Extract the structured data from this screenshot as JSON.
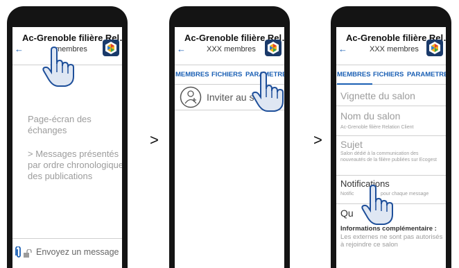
{
  "separators": {
    "first": ">",
    "second": ">"
  },
  "screen1": {
    "title": "Ac-Grenoble filière Rel…",
    "members": "membres",
    "annotation_1": "Page-écran des échanges",
    "annotation_2": "> Messages présentés par ordre chronologique des publications",
    "compose_placeholder": "Envoyez un message"
  },
  "screen2": {
    "title": "Ac-Grenoble filière Rel…",
    "members": "XXX membres",
    "tabs": [
      "MEMBRES",
      "FICHIERS",
      "PARAMETRES"
    ],
    "invite_label": "Inviter au s"
  },
  "screen3": {
    "title": "Ac-Grenoble filière Rel…",
    "members": "XXX membres",
    "tabs": [
      "MEMBRES",
      "FICHIERS",
      "PARAMETRES"
    ],
    "vignette": "Vignette du salon",
    "nom_title": "Nom du salon",
    "nom_sub": "Ac-Grenoble filière Relation Client",
    "sujet_title": "Sujet",
    "sujet_sub": "Salon dédié à la communication des nouveautés de la filière publiées sur Ecogest",
    "notif_title": "Notifications",
    "notif_sub_a": "Notific",
    "notif_sub_b": "pour chaque message",
    "qui_title": "Qu",
    "info_title": "Informations complémentaire :",
    "info_text": "Les externes ne sont pas autorisés à rejoindre ce salon"
  },
  "colors": {
    "accent": "#1a5fb4",
    "muted": "#9c9c9c",
    "frame": "#141414"
  }
}
